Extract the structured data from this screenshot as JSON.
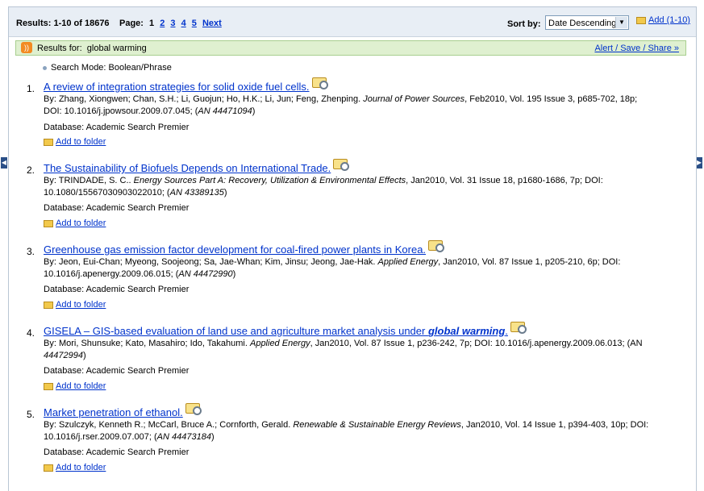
{
  "topbar": {
    "results_label": "Results: 1-10 of 18676",
    "page_label": "Page:",
    "pages": [
      "1",
      "2",
      "3",
      "4",
      "5"
    ],
    "next_label": "Next",
    "sort_label": "Sort by:",
    "sort_value": "Date Descending",
    "add_label": "Add (1-10)"
  },
  "results_for": {
    "label": "Results for:",
    "query": "global warming",
    "alert_label": "Alert / Save / Share »"
  },
  "search_mode": "Search Mode: Boolean/Phrase",
  "records": [
    {
      "num": "1.",
      "title": "A review of integration strategies for solid oxide fuel cells.",
      "line1_pre": "By: Zhang, Xiongwen; Chan, S.H.; Li, Guojun; Ho, H.K.; Li, Jun; Feng, Zhenping. ",
      "journal": "Journal of Power Sources",
      "line1_post": ", Feb2010, Vol. 195 Issue 3, p685-702, 18p;",
      "line2_pre": "DOI: 10.1016/j.jpowsour.2009.07.045; (",
      "an": "AN 44471094",
      "line2_post": ")",
      "database": "Database: Academic Search Premier",
      "folder": "Add to folder"
    },
    {
      "num": "2.",
      "title": "The Sustainability of Biofuels Depends on International Trade.",
      "line1_pre": "By: TRINDADE, S. C.. ",
      "journal": "Energy Sources Part A: Recovery, Utilization & Environmental Effects",
      "line1_post": ", Jan2010, Vol. 31 Issue 18, p1680-1686, 7p; DOI:",
      "line2_pre": "10.1080/15567030903022010; (",
      "an": "AN 43389135",
      "line2_post": ")",
      "database": "Database: Academic Search Premier",
      "folder": "Add to folder"
    },
    {
      "num": "3.",
      "title": "Greenhouse gas emission factor development for coal-fired power plants in Korea.",
      "line1_pre": "By: Jeon, Eui-Chan; Myeong, Soojeong; Sa, Jae-Whan; Kim, Jinsu; Jeong, Jae-Hak. ",
      "journal": "Applied Energy",
      "line1_post": ", Jan2010, Vol. 87 Issue 1, p205-210, 6p; DOI:",
      "line2_pre": "10.1016/j.apenergy.2009.06.015; (",
      "an": "AN 44472990",
      "line2_post": ")",
      "database": "Database: Academic Search Premier",
      "folder": "Add to folder"
    },
    {
      "num": "4.",
      "title": "GISELA – GIS-based evaluation of land use and agriculture market analysis under ",
      "title_em": "global warming",
      "title_end": ".",
      "line1_pre": "By: Mori, Shunsuke; Kato, Masahiro; Ido, Takahumi. ",
      "journal": "Applied Energy",
      "line1_post": ", Jan2010, Vol. 87 Issue 1, p236-242, 7p; DOI: 10.1016/j.apenergy.2009.06.013; (AN",
      "line2_pre": "",
      "an": "44472994",
      "line2_post": ")",
      "database": "Database: Academic Search Premier",
      "folder": "Add to folder"
    },
    {
      "num": "5.",
      "title": "Market penetration of ethanol.",
      "line1_pre": "By: Szulczyk, Kenneth R.; McCarl, Bruce A.; Cornforth, Gerald. ",
      "journal": "Renewable & Sustainable Energy Reviews",
      "line1_post": ", Jan2010, Vol. 14 Issue 1, p394-403, 10p; DOI:",
      "line2_pre": "10.1016/j.rser.2009.07.007; (",
      "an": "AN 44473184",
      "line2_post": ")",
      "database": "Database: Academic Search Premier",
      "folder": "Add to folder"
    }
  ]
}
